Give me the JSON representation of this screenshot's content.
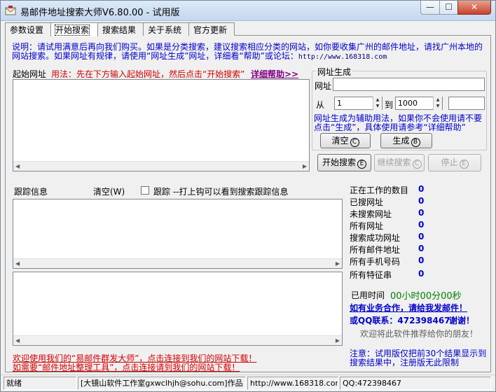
{
  "window": {
    "title": "易邮件地址搜索大师V6.80.00 - 试用版",
    "min": "—",
    "max": "☐",
    "close": "✕"
  },
  "tabs": [
    {
      "label": "参数设置"
    },
    {
      "label": "开始搜索"
    },
    {
      "label": "搜索结果"
    },
    {
      "label": "关于系统"
    },
    {
      "label": "官方更新"
    }
  ],
  "description": {
    "text": "说明：请试用满意后再向我们购买。如果是分类搜索，建议搜索相应分类的网站，如你要收集广州的邮件地址，请找广州本地的网站搜索。如果网址有规律，请使用“网址生成”网址，详细看“帮助”或论坛：",
    "url": "http://www.168318.com"
  },
  "start_url": {
    "label": "起始网址",
    "hint": "用法：先在下方输入起始网址，然后点击“开始搜索”",
    "help_link": "详细帮助>>"
  },
  "url_gen": {
    "title": "网址生成",
    "url_label": "网址",
    "url_value": "",
    "from_label": "从",
    "from_value": "1",
    "to_label": "到",
    "to_value": "1000",
    "extra_value": "",
    "note": "网址生成为辅助用法，如果你不会使用请不要点击“生成”，具体使用请参考“详细帮助”",
    "clear_btn": "清空",
    "clear_key": "C",
    "gen_btn": "生成",
    "gen_key": "B"
  },
  "actions": {
    "start": "开始搜索",
    "start_key": "E",
    "continue": "继续搜索",
    "continue_key": "C",
    "stop": "停止",
    "stop_key": "E"
  },
  "trace": {
    "label": "跟踪信息",
    "clear": "清空(W)",
    "checkbox_label": "跟踪 --打上钩可以看到搜索跟踪信息",
    "checked": false
  },
  "stats": [
    {
      "label": "正在工作的数目",
      "value": "0"
    },
    {
      "label": "已搜网址",
      "value": "0"
    },
    {
      "label": "未搜索网址",
      "value": "0"
    },
    {
      "label": "所有网址",
      "value": "0"
    },
    {
      "label": "搜索成功网址",
      "value": "0"
    },
    {
      "label": "所有邮件地址",
      "value": "0"
    },
    {
      "label": "所有手机号码",
      "value": "0"
    },
    {
      "label": "所有特征串",
      "value": "0"
    }
  ],
  "elapsed": {
    "label": "已用时间",
    "value": "00小时00分00秒"
  },
  "promo": {
    "business": "如有业务合作，请给我发邮件！",
    "qq": "或QQ联系：472398467",
    "thanks": "谢谢！",
    "recommend": "欢迎将此软件推荐给你的朋友！"
  },
  "footer_links": {
    "line1": "欢迎使用我们的“易邮件群发大师”，点击连接到我们的网站下载！",
    "line2": "如需要“邮件地址整理工具”，点击连接请到我们的网站下载！"
  },
  "trial_note": "注意：试用版仅把前30个结果显示到搜索结果中，注册版无此限制",
  "statusbar": {
    "status": "就绪",
    "author": "[大镜山软件工作室gxwclhjh@sohu.com]作品",
    "site": "http://www.168318.com",
    "qq": "QQ:472398467"
  },
  "colors": {
    "accent_blue": "#0000cc",
    "accent_red": "#d00000",
    "accent_green": "#008000",
    "accent_purple": "#800080"
  },
  "icons": [
    "app-envelope-icon",
    "minimize-icon",
    "maximize-icon",
    "close-icon",
    "spin-up-icon",
    "spin-down-icon",
    "scroll-left-icon",
    "scroll-right-icon"
  ]
}
